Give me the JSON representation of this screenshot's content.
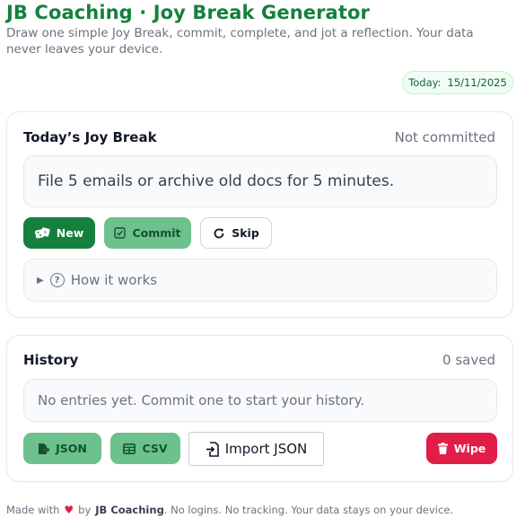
{
  "header": {
    "title": "JB Coaching · Joy Break Generator",
    "subtitle": "Draw one simple Joy Break, commit, complete, and jot a reflection. Your data never leaves your device."
  },
  "date_chip": {
    "label": "Today:",
    "value": "15/11/2025"
  },
  "today_card": {
    "title": "Today’s Joy Break",
    "status": "Not committed",
    "prompt": "File 5 emails or archive old docs for 5 minutes.",
    "buttons": {
      "new": "New",
      "commit": "Commit",
      "skip": "Skip"
    },
    "details_summary": "How it works"
  },
  "history_card": {
    "title": "History",
    "status": "0 saved",
    "empty_text": "No entries yet. Commit one to start your history.",
    "buttons": {
      "json": "JSON",
      "csv": "CSV",
      "import": "Import JSON",
      "wipe": "Wipe"
    }
  },
  "footer": {
    "made_with": "Made with",
    "by": "by",
    "brand": "JB Coaching",
    "rest": ". No logins. No tracking. Your data stays on your device."
  },
  "colors": {
    "brand_green": "#15803d",
    "soft_green": "#6cc18d",
    "danger": "#e11d48"
  },
  "icons": [
    "dice-icon",
    "checkbox-icon",
    "refresh-icon",
    "question-circle-icon",
    "file-export-icon",
    "table-icon",
    "file-import-icon",
    "trash-icon",
    "heart-icon"
  ]
}
